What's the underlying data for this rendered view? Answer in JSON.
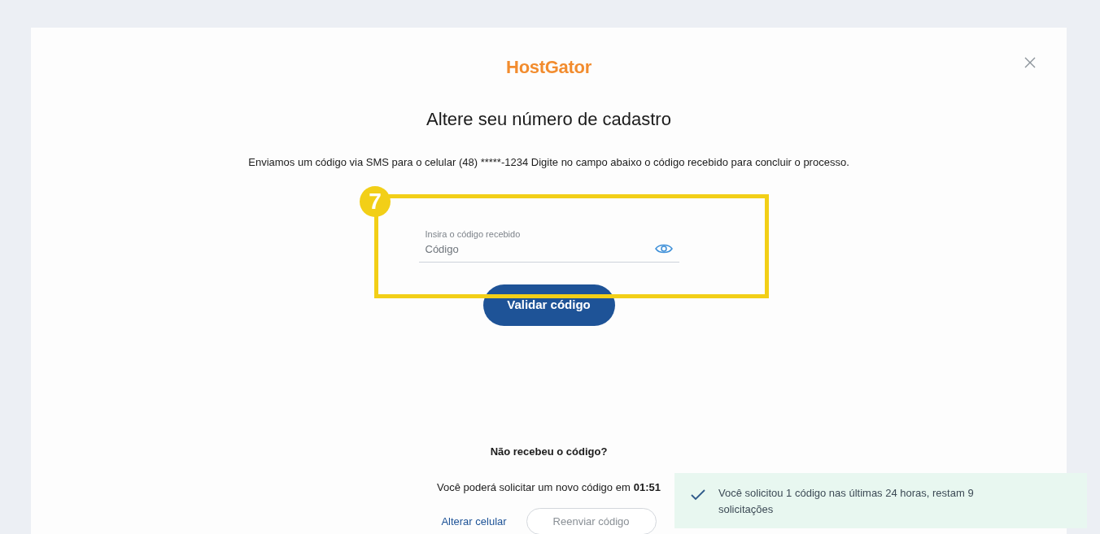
{
  "logo": "HostGator",
  "dialog": {
    "title": "Altere seu número de cadastro",
    "message": "Enviamos um código via SMS para o celular (48) *****-1234 Digite no campo abaixo o código recebido para concluir o processo.",
    "field": {
      "label": "Insira o código recebido",
      "placeholder": "Código"
    },
    "submit_button": "Validar código",
    "resend": {
      "question": "Não recebeu o código?",
      "timer_text": "Você poderá solicitar um novo código em",
      "timer": "01:51",
      "change_link": "Alterar celular",
      "resend_button": "Reenviar código",
      "resend_disabled": true
    }
  },
  "annotation": {
    "number": "7"
  },
  "toast": {
    "message": "Você solicitou 1 código nas últimas 24 horas, restam 9 solicitações"
  }
}
